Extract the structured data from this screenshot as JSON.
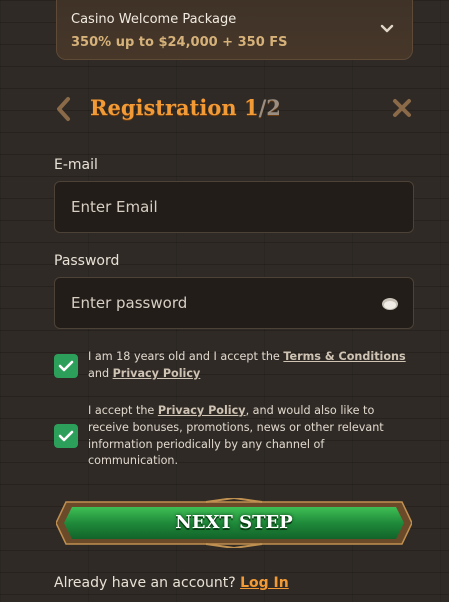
{
  "promo": {
    "title": "Casino Welcome Package",
    "subtitle": "350% up to $24,000 + 350 FS"
  },
  "header": {
    "title": "Registration ",
    "step_current": "1",
    "step_total": "/2"
  },
  "email": {
    "label": "E-mail",
    "placeholder": "Enter Email",
    "value": ""
  },
  "password": {
    "label": "Password",
    "placeholder": "Enter password",
    "value": ""
  },
  "consent_age": {
    "checked": true,
    "text_before": "I am 18 years old and I accept the ",
    "terms_link": "Terms & Conditions",
    "text_and": " and ",
    "privacy_link": "Privacy Policy"
  },
  "consent_marketing": {
    "checked": true,
    "text_before": "I accept the ",
    "privacy_link": "Privacy Policy",
    "text_after": ", and would also like to receive bonuses, promotions, news or other relevant information periodically by any channel of communication."
  },
  "next_button": {
    "label": "NEXT STEP"
  },
  "login": {
    "prompt": "Already have an account? ",
    "link": "Log In"
  },
  "colors": {
    "accent": "#f29a35",
    "button_green": "#1f8a3a",
    "checkbox_green": "#2ca05a",
    "background": "#2f2a25"
  },
  "icons": [
    "chevron-down-icon",
    "back-arrow-icon",
    "close-icon",
    "eye-icon",
    "checkmark-icon"
  ]
}
